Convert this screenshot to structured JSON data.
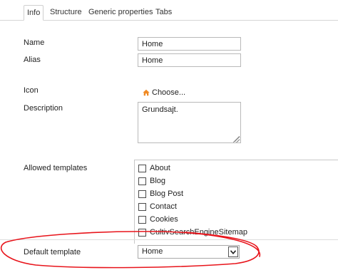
{
  "tabs": [
    {
      "label": "Info",
      "active": true
    },
    {
      "label": "Structure",
      "active": false
    },
    {
      "label": "Generic properties",
      "active": false
    },
    {
      "label": "Tabs",
      "active": false
    }
  ],
  "form": {
    "name_label": "Name",
    "name_value": "Home",
    "alias_label": "Alias",
    "alias_value": "Home",
    "icon_label": "Icon",
    "icon_choose": "Choose...",
    "description_label": "Description",
    "description_value": "Grundsajt.",
    "allowed_templates_label": "Allowed templates",
    "default_template_label": "Default template",
    "default_template_value": "Home"
  },
  "templates": [
    {
      "label": "About",
      "checked": false
    },
    {
      "label": "Blog",
      "checked": false
    },
    {
      "label": "Blog Post",
      "checked": false
    },
    {
      "label": "Contact",
      "checked": false
    },
    {
      "label": "Cookies",
      "checked": false
    },
    {
      "label": "CultivSearchEngineSitemap",
      "checked": false
    }
  ],
  "icons": {
    "icon_choose": "home-icon",
    "select_arrow": "chevron-down-icon"
  },
  "colors": {
    "annotation": "#e8141b",
    "home_icon": "#f08a24"
  }
}
